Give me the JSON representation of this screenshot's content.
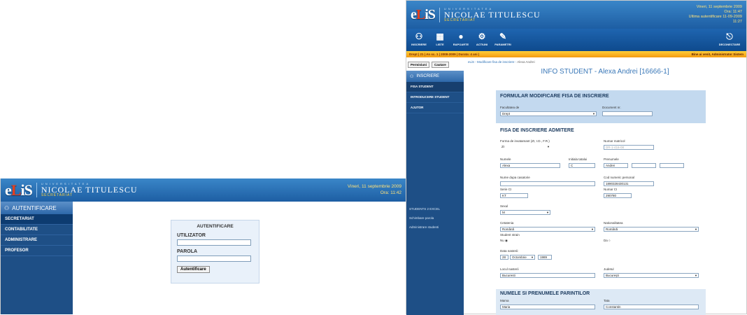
{
  "brand": {
    "logo_e": "e",
    "logo_L": "L",
    "logo_rest": "iS",
    "university_top": "UNIVERSITATEA",
    "university_name": "NICOLAE TITULESCU",
    "department": "SECRETARIAT"
  },
  "login": {
    "datetime_line1": "Vineri, 11 septembrie 2009",
    "datetime_line2": "Ora: 11:42",
    "sidebar_title": "AUTENTIFICARE",
    "sidebar_items": [
      "SECRETARIAT",
      "CONTABILITATE",
      "ADMINISTRARE",
      "PROFESOR"
    ],
    "panel_title": "AUTENTIFICARE",
    "user_label": "UTILIZATOR",
    "password_label": "PAROLA",
    "submit_label": "Autentificare"
  },
  "edit": {
    "datetime_line1": "Vineri, 11 septembrie 2009",
    "datetime_line2": "Ora: 11:47",
    "last_auth_line": "Ultima autentificare 11-09-2009",
    "last_auth_time": "11:27",
    "toolbar": [
      "INSCRIERE",
      "LISTE",
      "RAPOARTE",
      "ACTIUNI",
      "PARAMETRI"
    ],
    "logout": "DECONECTARE",
    "status_left": "Drept | 21 | An sc. 1 | 2008-2009 | Durata: 4 ani |",
    "status_right": "Bine ai venit, Administrator Sistem",
    "buttons": [
      "Permisiuni",
      "Cautare"
    ],
    "sidebar_title": "INSCRIERE",
    "sidebar_items": [
      "FISA STUDENT",
      "INTRODUCERE STUDENT",
      "AJUTOR"
    ],
    "sidebar_links": [
      "STUDENTS 2 EXCEL",
      "Schimbare parola",
      "Administrare studenti"
    ],
    "breadcrumb_link": "eLiS - Modificare fisa de inscriere -",
    "breadcrumb_current": "Alexa Andrei",
    "page_title": "INFO STUDENT - Alexa Andrei [16666-1]",
    "form_title": "FORMULAR MODIFICARE FISA DE INSCRIERE",
    "faculty_label": "Facultatea de",
    "faculty_value": "Drept",
    "document_label": "Document nr.",
    "section_title": "FISA DE INSCRIERE ADMITERE",
    "study_form_label": "Forma de invatamant (ZI, I.D., F.R.)",
    "study_form_value": "ZI",
    "matricol_label": "Numar matricol",
    "matricol_value": "DR-1-416-08",
    "surname_label": "Numele",
    "surname_value": "Alexa",
    "father_initial_label": "Initiala tatalui",
    "father_initial_value": "C",
    "firstname_label": "Prenumele",
    "firstname_value": "Andrei",
    "married_name_label": "Nume dupa casatorie",
    "cnp_label": "Cod numeric personal",
    "cnp_value": "1890328430131",
    "id_series_label": "Serie CI",
    "id_series_value": "KT",
    "id_number_label": "Numar CI",
    "id_number_value": "290780",
    "sex_label": "Sexul",
    "sex_value": "M",
    "citizenship_label": "Cetatenia",
    "citizenship_value": "Română",
    "nationality_label": "Nationalitatea",
    "nationality_value": "Română",
    "foreign_label": "Student strain",
    "no_label": "Nu",
    "yes_label": "Da",
    "birthdate_label": "Data nasterii:",
    "birth_day": "28",
    "birth_month": "Octombrie",
    "birth_year": "1989",
    "birthplace_label": "Locul nasterii",
    "birthplace_value": "Bucuresti",
    "county_label": "Judetul",
    "county_value": "Bucureşti",
    "parents_title": "NUMELE SI PRENUMELE PARINTILOR",
    "mother_label": "Mama",
    "mother_value": "Maria",
    "father_label": "Tata",
    "father_value": "Constantin"
  }
}
